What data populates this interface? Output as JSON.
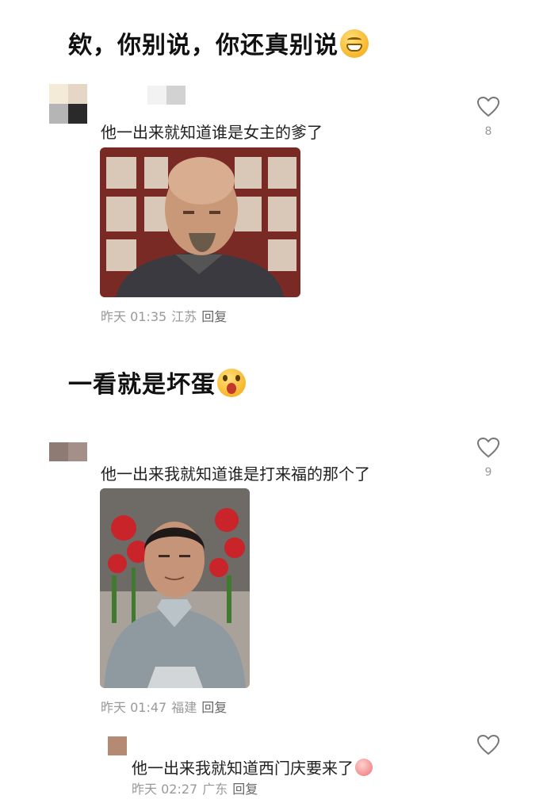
{
  "headings": [
    {
      "text": "欸，你别说，你还真别说",
      "emoji": "grin-face-emoji"
    },
    {
      "text": "一看就是坏蛋",
      "emoji": "shocked-face-emoji"
    }
  ],
  "comments": [
    {
      "text": "他一出来就知道谁是女主的爹了",
      "date": "昨天 01:35",
      "location": "江苏",
      "reply_label": "回复",
      "likes": "8"
    },
    {
      "text": "他一出来我就知道谁是打来福的那个了",
      "date": "昨天 01:47",
      "location": "福建",
      "reply_label": "回复",
      "likes": "9"
    },
    {
      "text": "他一出来我就知道西门庆要来了",
      "date": "昨天 02:27",
      "location": "广东",
      "reply_label": "回复",
      "likes": ""
    }
  ],
  "colors": {
    "text": "#222222",
    "meta": "#999999",
    "heart": "#777777",
    "background": "#ffffff"
  }
}
